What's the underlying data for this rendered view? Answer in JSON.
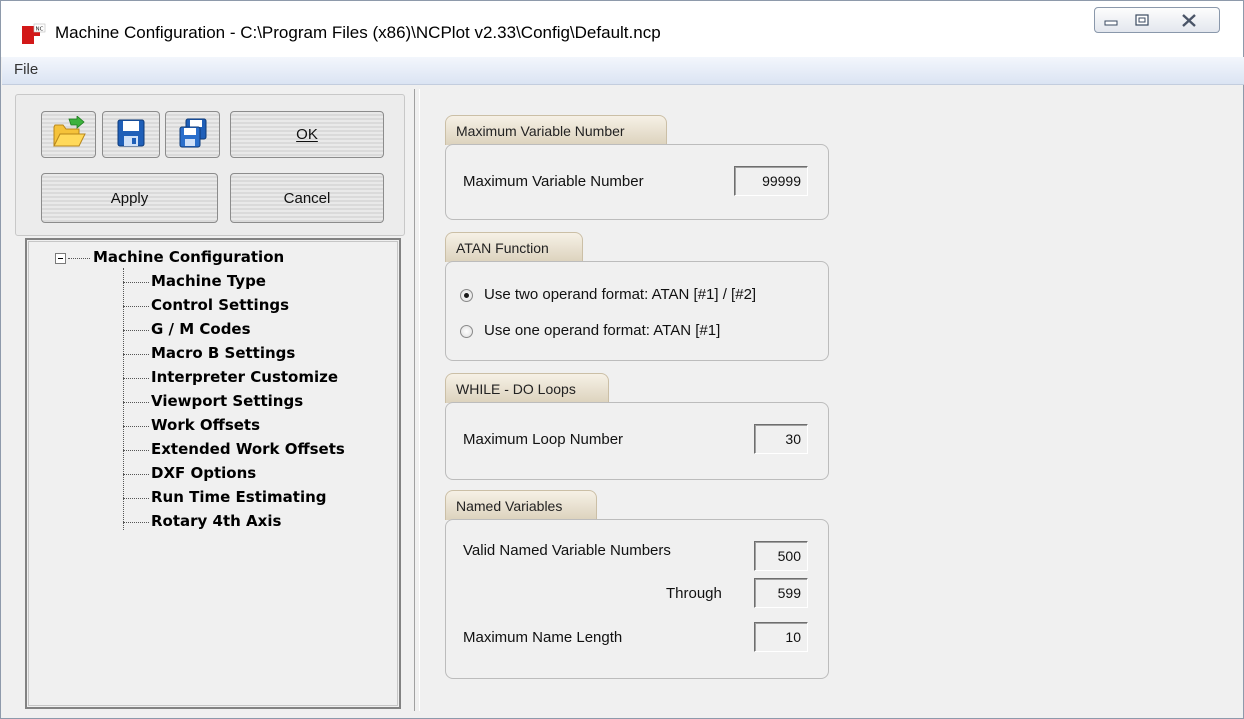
{
  "window": {
    "title": "Machine Configuration - C:\\Program Files (x86)\\NCPlot v2.33\\Config\\Default.ncp",
    "app_icon": "ncplot-app-icon",
    "caption_buttons": [
      "minimize-icon",
      "maximize-icon",
      "close-icon"
    ]
  },
  "menu": {
    "file": "File"
  },
  "toolbar": {
    "open_icon": "open-folder-icon",
    "save_icon": "save-disk-icon",
    "save_as_icon": "save-as-disk-icon",
    "ok_label": "OK",
    "apply_label": "Apply",
    "cancel_label": "Cancel"
  },
  "tree": {
    "root": "Machine Configuration",
    "items": [
      "Machine Type",
      "Control Settings",
      "G / M Codes",
      "Macro B Settings",
      "Interpreter Customize",
      "Viewport Settings",
      "Work Offsets",
      "Extended Work Offsets",
      "DXF Options",
      "Run Time Estimating",
      "Rotary 4th Axis"
    ]
  },
  "max_var": {
    "title": "Maximum Variable Number",
    "label": "Maximum Variable Number",
    "value": "99999"
  },
  "atan": {
    "title": "ATAN Function",
    "option1": "Use two operand format: ATAN [#1] / [#2]",
    "option2": "Use one operand format: ATAN [#1]",
    "selected": "option1"
  },
  "while_do": {
    "title": "WHILE - DO Loops",
    "label": "Maximum Loop Number",
    "value": "30"
  },
  "named_vars": {
    "title": "Named Variables",
    "valid_label": "Valid Named Variable Numbers",
    "valid_from": "500",
    "through_label": "Through",
    "valid_to": "599",
    "max_len_label": "Maximum Name Length",
    "max_len": "10"
  }
}
